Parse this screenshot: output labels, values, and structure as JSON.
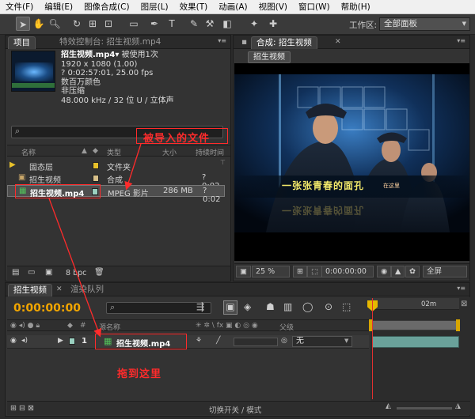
{
  "menu": [
    "文件(F)",
    "编辑(E)",
    "图像合成(C)",
    "图层(L)",
    "效果(T)",
    "动画(A)",
    "视图(V)",
    "窗口(W)",
    "帮助(H)"
  ],
  "toolbar": {
    "icons": [
      "selection-tool-icon",
      "hand-tool-icon",
      "zoom-tool-icon",
      "rotate-tool-icon",
      "camera-orbit-icon",
      "pan-behind-icon",
      "rectangle-mask-icon",
      "pen-tool-icon",
      "text-tool-icon",
      "brush-tool-icon",
      "clone-stamp-icon",
      "eraser-icon",
      "roto-brush-icon",
      "puppet-pin-icon"
    ],
    "workspace_label": "工作区:",
    "workspace_value": "全部面板"
  },
  "project_panel": {
    "tab_active": "项目",
    "tab_inactive": "特效控制台: 招生视频.mp4",
    "preview": {
      "name": "招生视频.mp4▾",
      "used": "被使用1次",
      "resolution": "1920 x 1080 (1.00)",
      "duration": "? 0:02:57:01, 25.00 fps",
      "color": "数百万颜色",
      "compression": "非压缩",
      "audio": "48.000 kHz / 32 位 U / 立体声"
    },
    "search_placeholder": "",
    "columns": {
      "name": "名称",
      "type": "类型",
      "size": "大小",
      "duration": "持续时间"
    },
    "items": [
      {
        "name": "固态层",
        "type": "文件夹",
        "size": "",
        "duration": "",
        "label_color": "#e8c12a"
      },
      {
        "name": "招生视频",
        "type": "合成",
        "size": "",
        "duration": "? 0:02",
        "label_color": "#d8c08a"
      },
      {
        "name": "招生视频.mp4",
        "type": "MPEG 影片",
        "size": "286 MB",
        "duration": "? 0:02",
        "label_color": "#9ad0c0"
      }
    ],
    "bpc": "8 bpc"
  },
  "comp_panel": {
    "tab": "合成: 招生视频",
    "comp_button": "招生视频",
    "caption_main": "一张张青春的面孔",
    "caption_small": "在这里",
    "zoom": "25 %",
    "timecode": "0:00:00:00",
    "resolution": "全屏"
  },
  "timeline": {
    "tab_active": "招生视频",
    "tab_inactive": "渲染队列",
    "current_time": "0:00:00:00",
    "columns": {
      "num": "#",
      "source_name": "源名称",
      "parent": "父级"
    },
    "ruler_marks": [
      "0",
      "02m"
    ],
    "layer": {
      "index": "1",
      "name": "招生视频.mp4",
      "parent": "无"
    },
    "footer_toggle": "切换开关 / 模式"
  },
  "annotations": {
    "imported_label": "被导入的文件",
    "drag_label": "拖到这里"
  }
}
